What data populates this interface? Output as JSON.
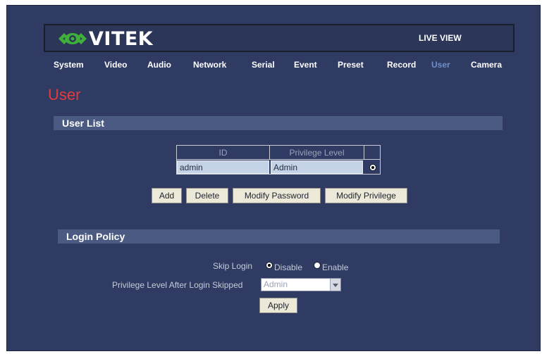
{
  "header": {
    "logo_text": "VITEK",
    "live_view": "LIVE VIEW"
  },
  "nav": {
    "items": [
      {
        "label": "System"
      },
      {
        "label": "Video"
      },
      {
        "label": "Audio"
      },
      {
        "label": "Network"
      },
      {
        "label": "Serial"
      },
      {
        "label": "Event"
      },
      {
        "label": "Preset"
      },
      {
        "label": "Record"
      },
      {
        "label": "User",
        "active": true
      },
      {
        "label": "Camera"
      }
    ]
  },
  "page": {
    "title": "User"
  },
  "user_list": {
    "heading": "User List",
    "columns": [
      "ID",
      "Privilege Level"
    ],
    "rows": [
      {
        "id": "admin",
        "privilege": "Admin",
        "selected": true
      }
    ],
    "buttons": {
      "add": "Add",
      "delete": "Delete",
      "modify_password": "Modify Password",
      "modify_privilege": "Modify Privilege"
    }
  },
  "login_policy": {
    "heading": "Login Policy",
    "skip_login_label": "Skip Login",
    "disable_label": "Disable",
    "enable_label": "Enable",
    "skip_login_value": "Disable",
    "privilege_after_label": "Privilege Level After Login Skipped",
    "privilege_after_value": "Admin",
    "apply": "Apply"
  },
  "colors": {
    "background": "#2f3b63",
    "section_bar": "#4a5a82",
    "title": "#e33b3b",
    "nav_active": "#6f8fc8",
    "logo_green": "#3fb03a"
  }
}
